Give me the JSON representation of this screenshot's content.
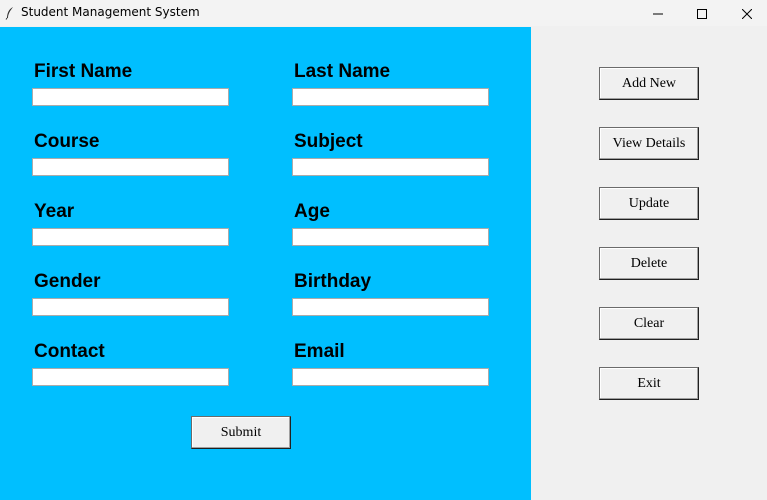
{
  "window": {
    "title": "Student Management System"
  },
  "form": {
    "background_color": "#00bfff",
    "fields": {
      "first_name": {
        "label": "First Name",
        "value": ""
      },
      "last_name": {
        "label": "Last Name",
        "value": ""
      },
      "course": {
        "label": "Course",
        "value": ""
      },
      "subject": {
        "label": "Subject",
        "value": ""
      },
      "year": {
        "label": "Year",
        "value": ""
      },
      "age": {
        "label": "Age",
        "value": ""
      },
      "gender": {
        "label": "Gender",
        "value": ""
      },
      "birthday": {
        "label": "Birthday",
        "value": ""
      },
      "contact": {
        "label": "Contact",
        "value": ""
      },
      "email": {
        "label": "Email",
        "value": ""
      }
    },
    "submit_label": "Submit"
  },
  "actions": {
    "add_new": "Add New",
    "view_details": "View Details",
    "update": "Update",
    "delete": "Delete",
    "clear": "Clear",
    "exit": "Exit"
  },
  "icons": {
    "app": "feather-icon",
    "minimize": "minimize-icon",
    "maximize": "maximize-icon",
    "close": "close-icon"
  }
}
